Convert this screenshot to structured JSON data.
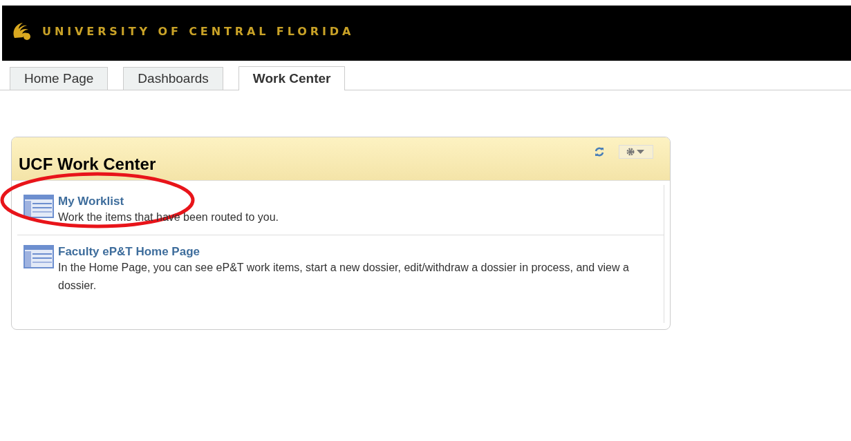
{
  "header": {
    "title": "UNIVERSITY OF CENTRAL FLORIDA"
  },
  "tabs": [
    {
      "label": "Home Page",
      "selected": false
    },
    {
      "label": "Dashboards",
      "selected": false
    },
    {
      "label": "Work Center",
      "selected": true
    }
  ],
  "panel": {
    "title": "UCF Work Center",
    "items": [
      {
        "title": "My Worklist",
        "description": "Work the items that have been routed to you."
      },
      {
        "title": "Faculty eP&T Home Page",
        "description": "In the Home Page, you can see eP&T work items, start a new dossier, edit/withdraw a dossier in process, and view a dossier."
      }
    ]
  }
}
